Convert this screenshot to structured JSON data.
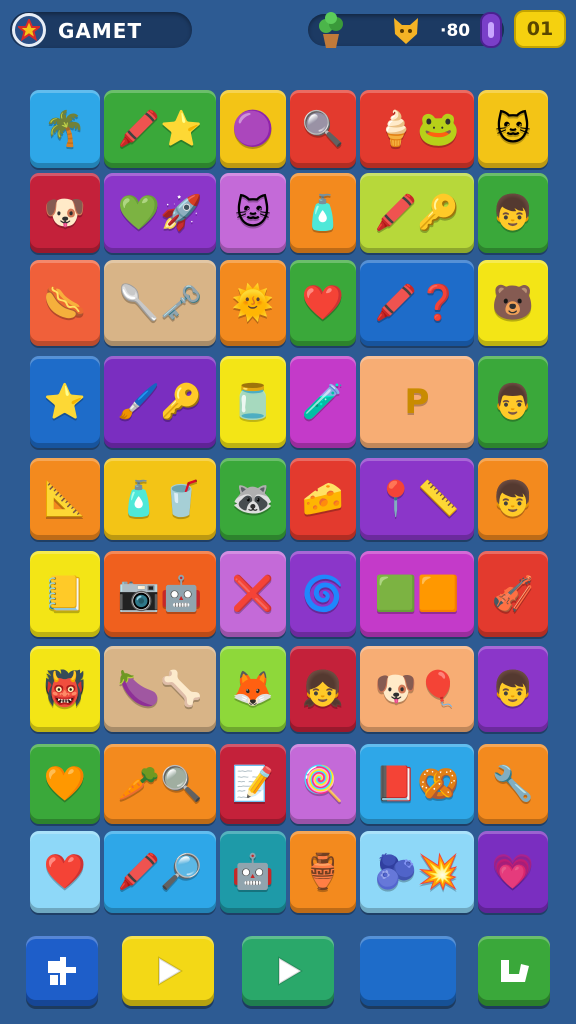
{
  "header": {
    "title": "GAMET",
    "resource_value": "·80",
    "level": "01",
    "icons": [
      "star-logo-icon",
      "potted-plant-icon",
      "cat-icon",
      "gem-icon"
    ]
  },
  "board": {
    "rows": [
      [
        {
          "name": "palm-tree-icon",
          "color": "#2ea7e8",
          "glyph": "🌴"
        },
        {
          "name": "crayon-and-star-icons",
          "color": "#3aa83a",
          "glyph": "🖍️⭐",
          "wide": true
        },
        {
          "name": "purple-bug-icon",
          "color": "#f3c416",
          "glyph": "🟣"
        },
        {
          "name": "magnifier-icon",
          "color": "#e33a2e",
          "glyph": "🔍"
        },
        {
          "name": "cone-and-frog-icons",
          "color": "#e33a2e",
          "glyph": "🍦🐸",
          "wide": true
        },
        {
          "name": "cat-face-icon",
          "color": "#f3c416",
          "glyph": "🐱"
        }
      ],
      [
        {
          "name": "chef-dog-icon",
          "color": "#c4213a",
          "glyph": "🐶"
        },
        {
          "name": "heart-and-rocket-icons",
          "color": "#8b36c9",
          "glyph": "💚🚀",
          "wide": true
        },
        {
          "name": "white-cat-icon",
          "color": "#c46ad8",
          "glyph": "🐱"
        },
        {
          "name": "bottle-icon",
          "color": "#f38a1e",
          "glyph": "🧴"
        },
        {
          "name": "crayon-and-key-icons",
          "color": "#b7d83a",
          "glyph": "🖍️🔑",
          "wide": true
        },
        {
          "name": "boy-face-icon",
          "color": "#3aa83a",
          "glyph": "👦"
        }
      ],
      [
        {
          "name": "sausage-icon",
          "color": "#f0603a",
          "glyph": "🌭"
        },
        {
          "name": "spoon-and-key-icons",
          "color": "#d8b487",
          "glyph": "🥄🗝️",
          "wide": true
        },
        {
          "name": "sun-icon",
          "color": "#f38a1e",
          "glyph": "🌞"
        },
        {
          "name": "heart-icon",
          "color": "#3aa83a",
          "glyph": "❤️"
        },
        {
          "name": "crayon-and-hook-icons",
          "color": "#1e6cc9",
          "glyph": "🖍️❓",
          "wide": true
        },
        {
          "name": "bear-face-icon",
          "color": "#f3e516",
          "glyph": "🐻"
        }
      ],
      [
        {
          "name": "star-face-icon",
          "color": "#1e6cc9",
          "glyph": "⭐"
        },
        {
          "name": "brush-and-key-icons",
          "color": "#7a2ec0",
          "glyph": "🖌️🔑",
          "wide": true
        },
        {
          "name": "jar-icon",
          "color": "#f3e516",
          "glyph": "🫙"
        },
        {
          "name": "potion-bottle-icon",
          "color": "#c43ac9",
          "glyph": "🧪"
        },
        {
          "name": "letter-p-icon",
          "color": "#f7ad74",
          "glyph": "P",
          "text": true,
          "wide": true
        },
        {
          "name": "man-face-icon",
          "color": "#3aa83a",
          "glyph": "👨"
        }
      ],
      [
        {
          "name": "metronome-icon",
          "color": "#f38a1e",
          "glyph": "📐"
        },
        {
          "name": "bottle-and-cup-icons",
          "color": "#f3c416",
          "glyph": "🧴🥤",
          "wide": true
        },
        {
          "name": "raccoon-icon",
          "color": "#3aa83a",
          "glyph": "🦝"
        },
        {
          "name": "cheese-icon",
          "color": "#e33a2e",
          "glyph": "🧀"
        },
        {
          "name": "map-pin-and-ruler-icons",
          "color": "#8b36c9",
          "glyph": "📍📏",
          "wide": true
        },
        {
          "name": "boy-head-icon",
          "color": "#f38a1e",
          "glyph": "👦"
        }
      ],
      [
        {
          "name": "notebook-icon",
          "color": "#f3e516",
          "glyph": "📒"
        },
        {
          "name": "camera-and-robot-icons",
          "color": "#f0601e",
          "glyph": "📷🤖",
          "wide": true
        },
        {
          "name": "x-mark-icon",
          "color": "#c46ad8",
          "glyph": "❌"
        },
        {
          "name": "letter-c-icon",
          "color": "#8b36c9",
          "glyph": "🌀"
        },
        {
          "name": "block-shapes-icons",
          "color": "#c43ac9",
          "glyph": "🟩🟧",
          "wide": true
        },
        {
          "name": "harp-icon",
          "color": "#e33a2e",
          "glyph": "🎻"
        }
      ],
      [
        {
          "name": "monster-icon",
          "color": "#f3e516",
          "glyph": "👹"
        },
        {
          "name": "eggplant-and-bone-icons",
          "color": "#d8b487",
          "glyph": "🍆🦴",
          "wide": true
        },
        {
          "name": "fox-face-icon",
          "color": "#8ed83a",
          "glyph": "🦊"
        },
        {
          "name": "girl-face-icon",
          "color": "#c4213a",
          "glyph": "👧"
        },
        {
          "name": "dog-and-balloon-icons",
          "color": "#f7ad74",
          "glyph": "🐶🎈",
          "wide": true
        },
        {
          "name": "green-hair-boy-icon",
          "color": "#8b36c9",
          "glyph": "👦"
        }
      ],
      [
        {
          "name": "orange-heart-icon",
          "color": "#3aa83a",
          "glyph": "🧡"
        },
        {
          "name": "carrot-and-magnifier-icons",
          "color": "#f38a1e",
          "glyph": "🥕🔍",
          "wide": true
        },
        {
          "name": "paper-and-pencil-icon",
          "color": "#c4213a",
          "glyph": "📝"
        },
        {
          "name": "popsicle-icon",
          "color": "#c46ad8",
          "glyph": "🍭"
        },
        {
          "name": "book-and-knot-icons",
          "color": "#2ea7e8",
          "glyph": "📕🥨",
          "wide": true
        },
        {
          "name": "wrench-icon",
          "color": "#f38a1e",
          "glyph": "🔧"
        }
      ],
      [
        {
          "name": "red-heart-icon",
          "color": "#8ed8f8",
          "glyph": "❤️"
        },
        {
          "name": "crayon-and-search-icons",
          "color": "#2ea7e8",
          "glyph": "🖍️🔎",
          "wide": true
        },
        {
          "name": "robot-icon",
          "color": "#1e9aa8",
          "glyph": "🤖"
        },
        {
          "name": "potion-jar-icon",
          "color": "#f38a1e",
          "glyph": "🏺"
        },
        {
          "name": "plum-and-splat-icons",
          "color": "#8ed8f8",
          "glyph": "🫐💥",
          "wide": true
        },
        {
          "name": "heart-badge-icon",
          "color": "#7a2ec0",
          "glyph": "💗"
        }
      ]
    ]
  },
  "buttons": [
    {
      "name": "shuffle-button",
      "color": "#1e5ec9",
      "icon": "puzzle-icon"
    },
    {
      "name": "play-button-yellow",
      "color": "#f3d816",
      "icon": "play-icon"
    },
    {
      "name": "play-button-green",
      "color": "#2aa86a",
      "icon": "play-icon"
    },
    {
      "name": "blank-button",
      "color": "#1e6cc9",
      "icon": ""
    },
    {
      "name": "check-button",
      "color": "#3aa83a",
      "icon": "check-icon"
    }
  ]
}
